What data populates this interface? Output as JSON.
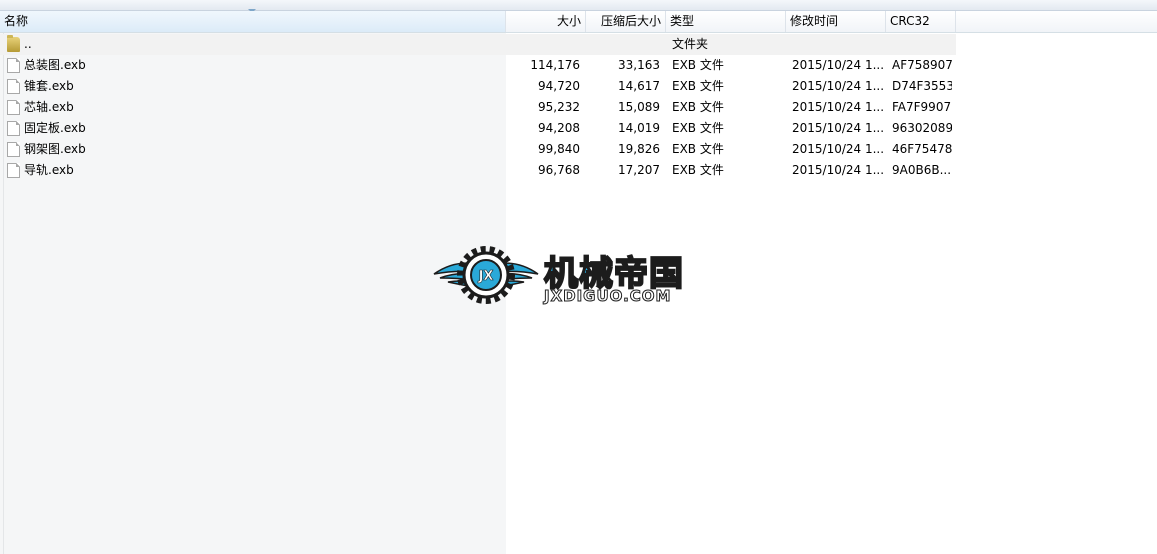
{
  "columns": {
    "name": "名称",
    "size": "大小",
    "compressed": "压缩后大小",
    "type": "类型",
    "modified": "修改时间",
    "crc": "CRC32"
  },
  "updir": {
    "name": "..",
    "type": "文件夹"
  },
  "files": [
    {
      "name": "总装图.exb",
      "size": "114,176",
      "compressed": "33,163",
      "type": "EXB 文件",
      "modified": "2015/10/24 1...",
      "crc": "AF758907"
    },
    {
      "name": "锥套.exb",
      "size": "94,720",
      "compressed": "14,617",
      "type": "EXB 文件",
      "modified": "2015/10/24 1...",
      "crc": "D74F3553"
    },
    {
      "name": "芯轴.exb",
      "size": "95,232",
      "compressed": "15,089",
      "type": "EXB 文件",
      "modified": "2015/10/24 1...",
      "crc": "FA7F9907"
    },
    {
      "name": "固定板.exb",
      "size": "94,208",
      "compressed": "14,019",
      "type": "EXB 文件",
      "modified": "2015/10/24 1...",
      "crc": "96302089"
    },
    {
      "name": "钢架图.exb",
      "size": "99,840",
      "compressed": "19,826",
      "type": "EXB 文件",
      "modified": "2015/10/24 1...",
      "crc": "46F75478"
    },
    {
      "name": "导轨.exb",
      "size": "96,768",
      "compressed": "17,207",
      "type": "EXB 文件",
      "modified": "2015/10/24 1...",
      "crc": "9A0B6B..."
    }
  ],
  "watermark": {
    "emblem_text": "JX",
    "title": "机械帝国",
    "subtitle": "JXDIGUO.COM",
    "colors": {
      "accent": "#27b4ee",
      "outline": "#1c1c1c"
    }
  },
  "icons": {
    "file": "file-icon",
    "folder": "folder-icon",
    "sort": "sort-arrow-icon"
  }
}
